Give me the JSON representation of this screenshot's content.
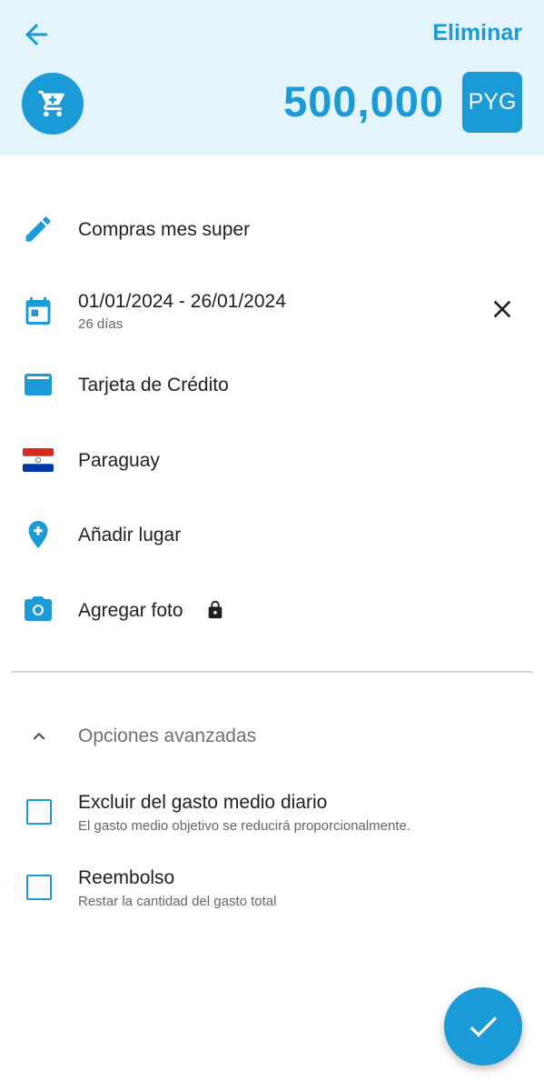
{
  "header": {
    "delete_label": "Eliminar",
    "amount": "500,000",
    "currency": "PYG",
    "category_icon": "shopping-cart-icon"
  },
  "fields": {
    "description": "Compras mes super",
    "date_range": "01/01/2024 - 26/01/2024",
    "date_days": "26 días",
    "payment_method": "Tarjeta de Crédito",
    "country": "Paraguay",
    "place": "Añadir lugar",
    "photo": "Agregar foto"
  },
  "advanced": {
    "title": "Opciones avanzadas",
    "options": [
      {
        "label": "Excluir del gasto medio diario",
        "description": "El gasto medio objetivo se reducirá proporcionalmente.",
        "checked": false
      },
      {
        "label": "Reembolso",
        "description": "Restar la cantidad del gasto total",
        "checked": false
      }
    ]
  },
  "colors": {
    "accent": "#1a9ad6",
    "header_bg": "#e3f4fb"
  }
}
